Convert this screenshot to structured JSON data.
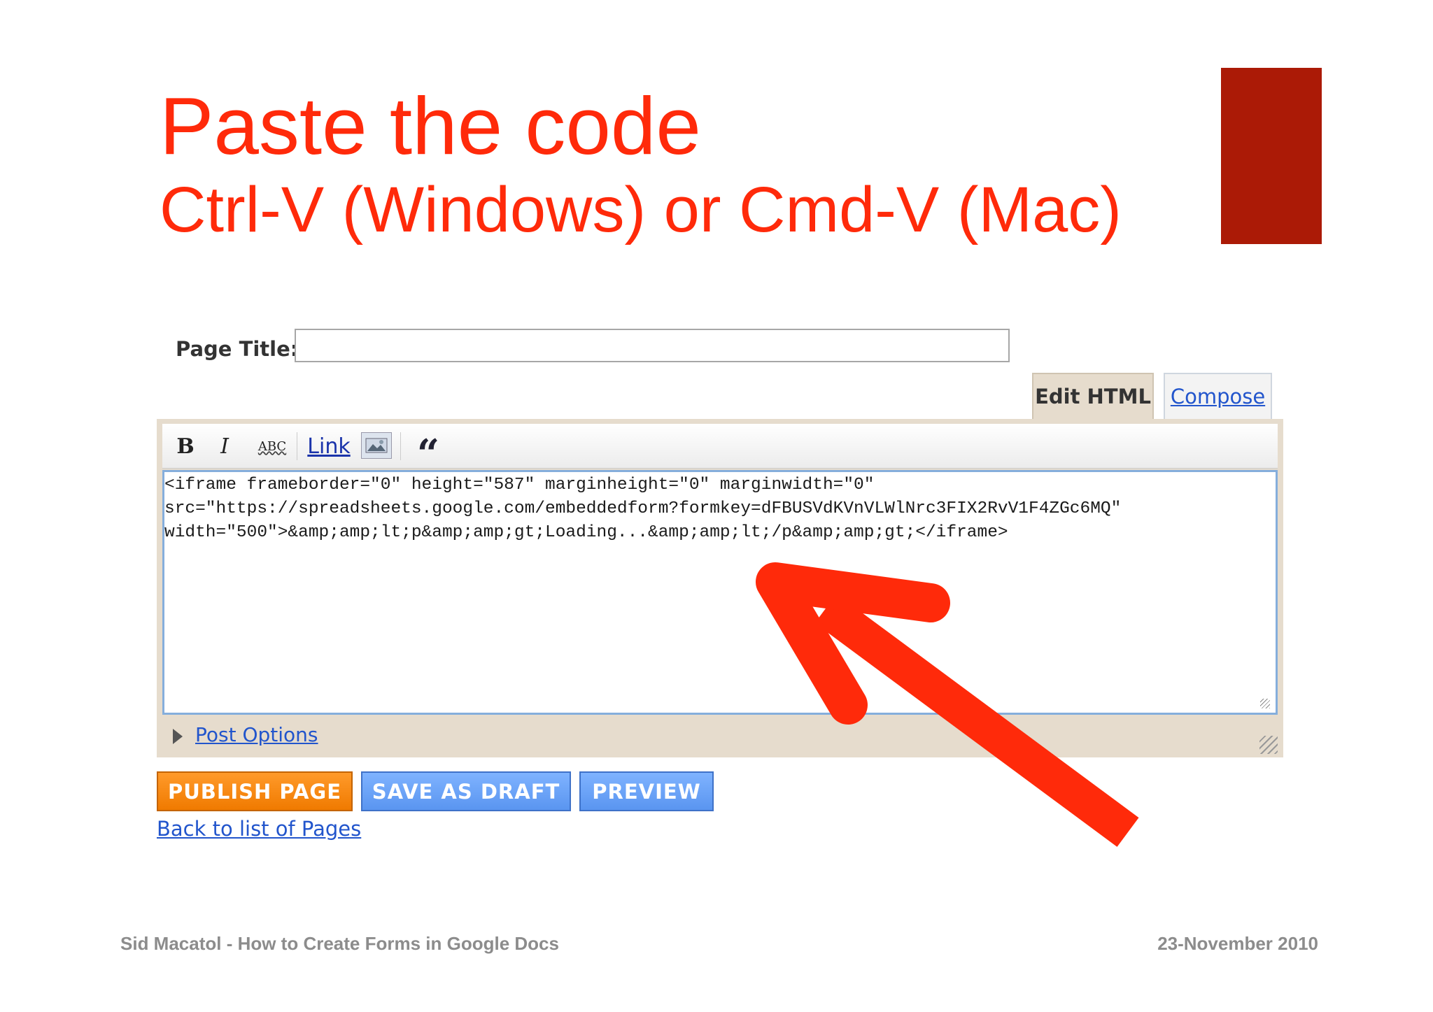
{
  "slide": {
    "title": "Paste the code",
    "subtitle": "Ctrl-V (Windows) or Cmd-V (Mac)",
    "accent_color": "#ab1a06",
    "title_color": "#ff2a0a"
  },
  "form": {
    "page_title_label": "Page Title:",
    "page_title_value": ""
  },
  "tabs": {
    "edit_html": "Edit HTML",
    "compose": "Compose"
  },
  "toolbar": {
    "bold": "B",
    "italic": "I",
    "spell": "ABC",
    "link": "Link",
    "quote": "“"
  },
  "editor": {
    "lines": [
      "<iframe frameborder=\"0\" height=\"587\" marginheight=\"0\" marginwidth=\"0\"",
      "src=\"https://spreadsheets.google.com/embeddedform?formkey=dFBUSVdKVnVLWlNrc3FIX2RvV1F4ZGc6MQ\"",
      "width=\"500\">&amp;amp;lt;p&amp;amp;gt;Loading...&amp;amp;lt;/p&amp;amp;gt;</iframe>"
    ]
  },
  "post_options": "Post Options",
  "buttons": {
    "publish": "PUBLISH PAGE",
    "draft": "SAVE AS DRAFT",
    "preview": "PREVIEW"
  },
  "back_link": "Back to list of Pages",
  "footer": {
    "left": "Sid Macatol - How to Create Forms in Google Docs",
    "right": "23-November 2010"
  },
  "annotation": {
    "arrow_color": "#ff2a0a"
  }
}
